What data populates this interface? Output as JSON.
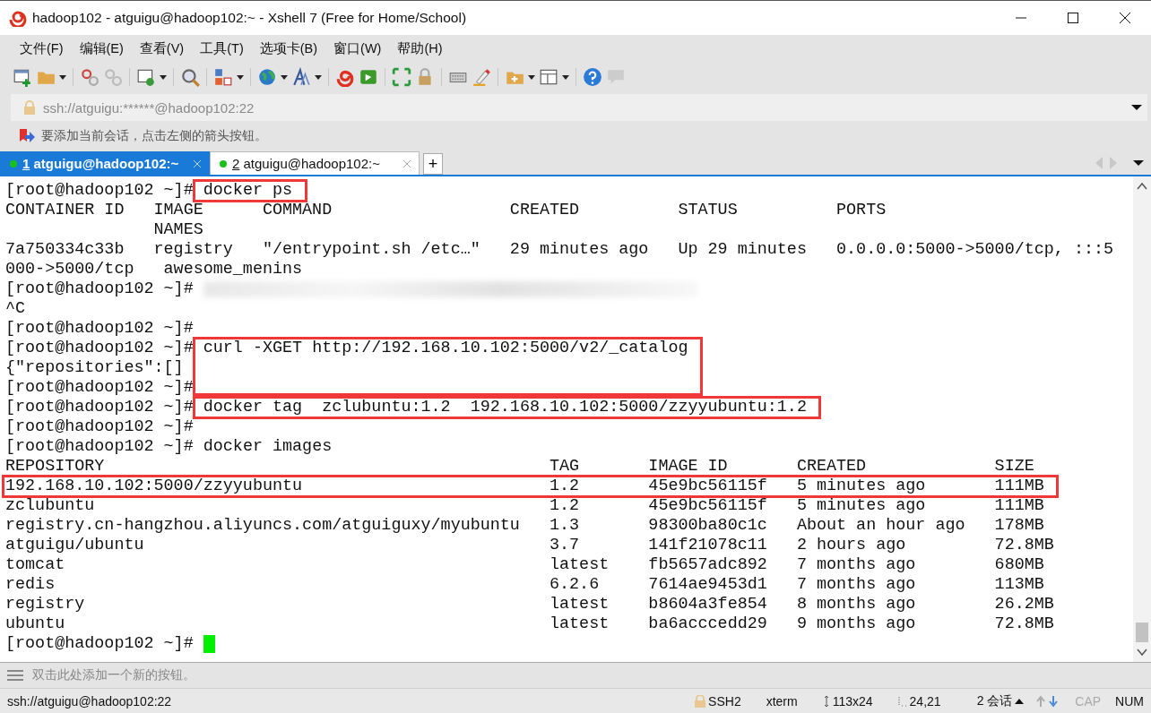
{
  "window": {
    "title": "hadoop102 - atguigu@hadoop102:~ - Xshell 7 (Free for Home/School)"
  },
  "menu": [
    "文件(F)",
    "编辑(E)",
    "查看(V)",
    "工具(T)",
    "选项卡(B)",
    "窗口(W)",
    "帮助(H)"
  ],
  "address_bar": {
    "value": "ssh://atguigu:******@hadoop102:22"
  },
  "hint_bar": {
    "text": "要添加当前会话，点击左侧的箭头按钮。"
  },
  "tabs": [
    {
      "number": "1",
      "title": "atguigu@hadoop102:~",
      "selected": true,
      "connected": true
    },
    {
      "number": "2",
      "title": "atguigu@hadoop102:~",
      "selected": false,
      "connected": true
    }
  ],
  "new_tab": "+",
  "terminal": {
    "cursor_visible": true,
    "lines": [
      {
        "prompt": "[root@hadoop102 ~]# ",
        "text": "docker ps",
        "marked": true,
        "redacted": false
      },
      {
        "text": "CONTAINER ID   IMAGE      COMMAND                  CREATED          STATUS          PORTS",
        "marked": false,
        "redacted": false
      },
      {
        "text": "               NAMES",
        "marked": false,
        "redacted": false
      },
      {
        "text": "7a750334c33b   registry   \"/entrypoint.sh /etc…\"   29 minutes ago   Up 29 minutes   0.0.0.0:5000->5000/tcp, :::5",
        "marked": false,
        "redacted": false
      },
      {
        "text": "000->5000/tcp   awesome_menins",
        "marked": false,
        "redacted": false
      },
      {
        "prompt": "[root@hadoop102 ~]# ",
        "marked": false,
        "redacted": true
      },
      {
        "text": "^C",
        "marked": false,
        "redacted": false
      },
      {
        "prompt": "[root@hadoop102 ~]# ",
        "marked": false,
        "redacted": false
      },
      {
        "prompt": "[root@hadoop102 ~]# ",
        "text": "curl -XGET http://192.168.10.102:5000/v2/_catalog",
        "marked": true,
        "redacted": false
      },
      {
        "text": "{\"repositories\":[]",
        "marked": true,
        "redacted": false
      },
      {
        "prompt": "[root@hadoop102 ~]# ",
        "marked": false,
        "redacted": false
      },
      {
        "prompt": "[root@hadoop102 ~]# ",
        "text": "docker tag  zclubuntu:1.2  192.168.10.102:5000/zzyyubuntu:1.2",
        "marked": true,
        "redacted": false
      },
      {
        "prompt": "[root@hadoop102 ~]# ",
        "marked": false,
        "redacted": false
      },
      {
        "prompt": "[root@hadoop102 ~]# ",
        "text": "docker images",
        "marked": false,
        "redacted": false
      },
      {
        "text": "REPOSITORY                                             TAG       IMAGE ID       CREATED             SIZE",
        "marked": false,
        "redacted": false
      },
      {
        "text": "192.168.10.102:5000/zzyyubuntu                         1.2       45e9bc56115f   5 minutes ago       111MB",
        "marked": true,
        "redacted": false
      },
      {
        "text": "zclubuntu                                              1.2       45e9bc56115f   5 minutes ago       111MB",
        "marked": false,
        "redacted": false
      },
      {
        "text": "registry.cn-hangzhou.aliyuncs.com/atguiguxy/myubuntu   1.3       98300ba80c1c   About an hour ago   178MB",
        "marked": false,
        "redacted": false
      },
      {
        "text": "atguigu/ubuntu                                         3.7       141f21078c11   2 hours ago         72.8MB",
        "marked": false,
        "redacted": false
      },
      {
        "text": "tomcat                                                 latest    fb5657adc892   7 months ago        680MB",
        "marked": false,
        "redacted": false
      },
      {
        "text": "redis                                                  6.2.6     7614ae9453d1   7 months ago        113MB",
        "marked": false,
        "redacted": false
      },
      {
        "text": "registry                                               latest    b8604a3fe854   8 months ago        26.2MB",
        "marked": false,
        "redacted": false
      },
      {
        "text": "ubuntu                                                 latest    ba6acccedd29   9 months ago        72.8MB",
        "marked": false,
        "redacted": false
      },
      {
        "prompt": "[root@hadoop102 ~]# ",
        "marked": false,
        "redacted": false
      }
    ]
  },
  "button_bar": {
    "text": "双击此处添加一个新的按钮。"
  },
  "status_bar": {
    "connection": "ssh://atguigu@hadoop102:22",
    "items": [
      {
        "kind": "protocol",
        "text": "SSH2"
      },
      {
        "kind": "plain",
        "text": "xterm"
      },
      {
        "kind": "size",
        "text": "113x24"
      },
      {
        "kind": "position",
        "text": "24,21"
      },
      {
        "kind": "sessions",
        "text": "2 会话"
      },
      {
        "kind": "key",
        "text": "CAP",
        "on": false
      },
      {
        "kind": "key",
        "text": "NUM",
        "on": true
      }
    ]
  }
}
